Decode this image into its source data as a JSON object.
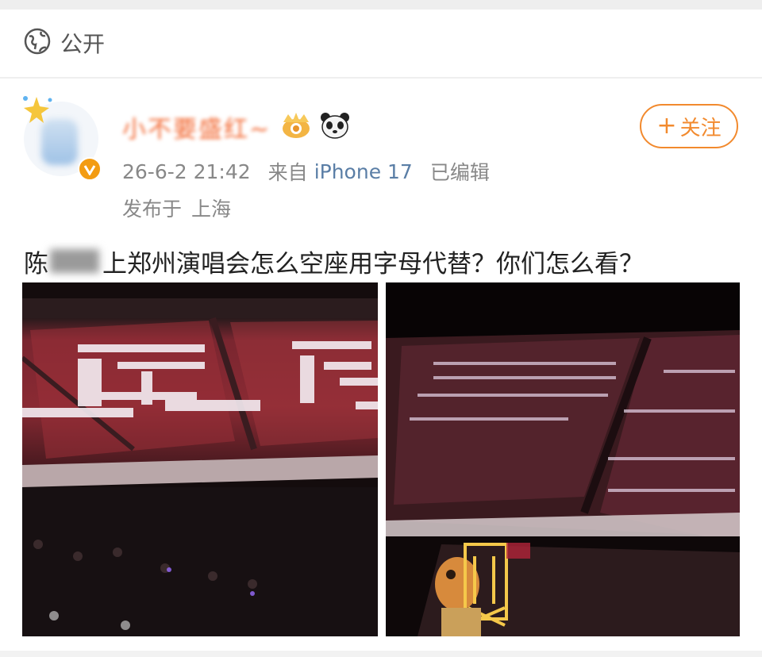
{
  "visibility": {
    "label": "公开",
    "icon": "globe-icon"
  },
  "post": {
    "author": {
      "name": "小不要盛红~",
      "verified": true
    },
    "follow_button": "关注",
    "timestamp": "26-6-2 21:42",
    "source_prefix": "来自",
    "source_device": "iPhone 17",
    "edited": "已编辑",
    "location_prefix": "发布于",
    "location": "上海",
    "text_start": "陈",
    "text_rest": "上郑州演唱会怎么空座用字母代替？你们怎么看？",
    "images": [
      {
        "alt": "stadium-seats-with-light-letters"
      },
      {
        "alt": "stadium-seats-night-with-lit-figure"
      }
    ]
  },
  "colors": {
    "accent": "#f28a2e",
    "link": "#5a7ea6",
    "meta": "#888888"
  }
}
